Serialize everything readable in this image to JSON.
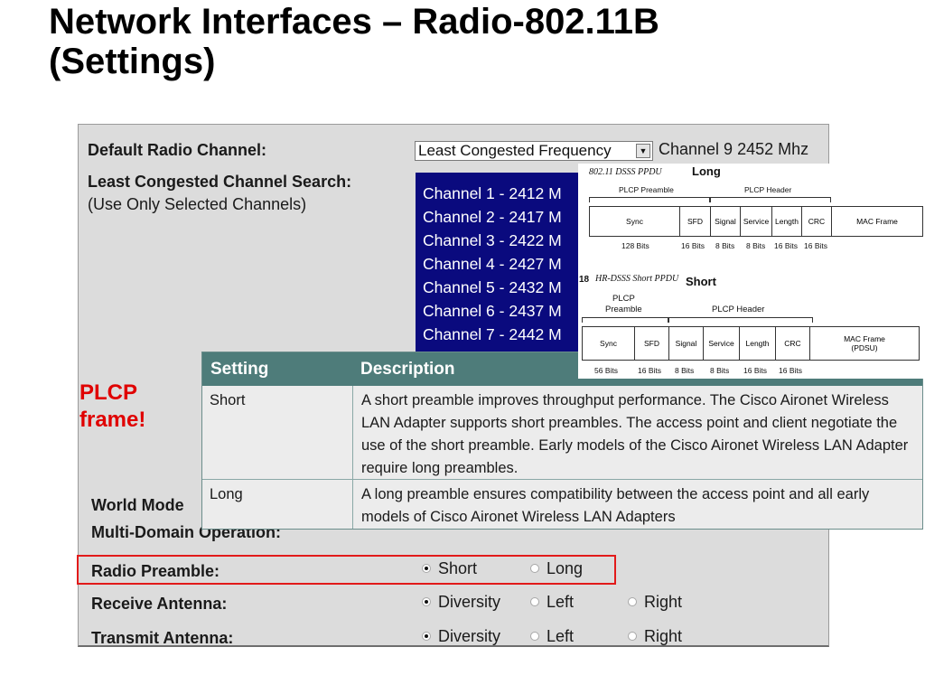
{
  "slide": {
    "title_line1": "Network Interfaces – Radio-802.11B",
    "title_line2": "(Settings)"
  },
  "panel": {
    "default_channel_label": "Default Radio Channel:",
    "default_channel_value": "Least Congested Frequency",
    "channel_readout": "Channel 9 2452 Mhz",
    "search_label": "Least Congested Channel Search:",
    "search_hint": "(Use Only Selected Channels)",
    "channels": [
      "Channel 1 - 2412 M",
      "Channel 2 - 2417 M",
      "Channel 3 - 2422 M",
      "Channel 4 - 2427 M",
      "Channel 5 - 2432 M",
      "Channel 6 - 2437 M",
      "Channel 7 - 2442 M"
    ],
    "world_mode_label": "World Mode",
    "multi_domain_label": "Multi-Domain Operation:",
    "preamble": {
      "label": "Radio Preamble:",
      "options": [
        "Short",
        "Long"
      ],
      "selected": "Short"
    },
    "receive_antenna": {
      "label": "Receive Antenna:",
      "options": [
        "Diversity",
        "Left",
        "Right"
      ],
      "selected": "Diversity"
    },
    "transmit_antenna": {
      "label": "Transmit Antenna:",
      "options": [
        "Diversity",
        "Left",
        "Right"
      ],
      "selected": "Diversity"
    }
  },
  "table": {
    "headers": [
      "Setting",
      "Description"
    ],
    "rows": [
      {
        "setting": "Short",
        "description": "A short preamble improves throughput performance. The Cisco Aironet Wireless LAN Adapter supports short preambles. The access point and client negotiate the use of the short preamble. Early models of the Cisco Aironet Wireless LAN Adapter require long preambles."
      },
      {
        "setting": "Long",
        "description": "A long preamble ensures compatibility between the access point and all early models of Cisco Aironet Wireless LAN Adapters"
      }
    ]
  },
  "annotation": {
    "line1": "PLCP",
    "line2": "frame!"
  },
  "ppdu": {
    "long": {
      "caption": "802.11 DSSS PPDU",
      "tag": "Long",
      "preamble_label": "PLCP Preamble",
      "header_label": "PLCP Header",
      "fields": [
        "Sync",
        "SFD",
        "Signal",
        "Service",
        "Length",
        "CRC",
        "MAC Frame"
      ],
      "bits": [
        "128 Bits",
        "16 Bits",
        "8 Bits",
        "8 Bits",
        "16 Bits",
        "16 Bits"
      ]
    },
    "short": {
      "fig_no": "18",
      "caption": "HR-DSSS Short PPDU",
      "tag": "Short",
      "preamble_label_1": "PLCP",
      "preamble_label_2": "Preamble",
      "header_label": "PLCP Header",
      "fields": [
        "Sync",
        "SFD",
        "Signal",
        "Service",
        "Length",
        "CRC"
      ],
      "mac_line1": "MAC Frame",
      "mac_line2": "(PDSU)",
      "bits": [
        "56 Bits",
        "16 Bits",
        "8 Bits",
        "8 Bits",
        "16 Bits",
        "16 Bits"
      ]
    }
  },
  "colors": {
    "listbox_bg": "#0a0a7e",
    "table_header": "#4e7c7a",
    "highlight": "#e21a1a",
    "annotation": "#e00000"
  }
}
